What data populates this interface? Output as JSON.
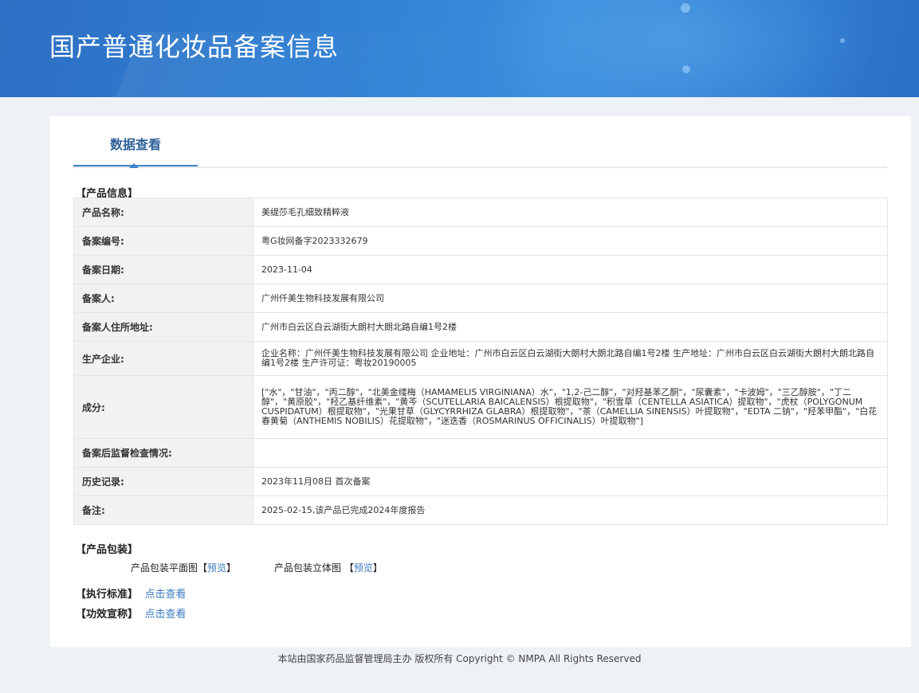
{
  "header": {
    "title": "国产普通化妆品备案信息"
  },
  "tab": {
    "label": "数据查看"
  },
  "product_info": {
    "section_label": "【产品信息】",
    "rows": [
      {
        "key": "产品名称:",
        "value": "美缇莎毛孔细致精粹液"
      },
      {
        "key": "备案编号:",
        "value": "粤G妆网备字2023332679"
      },
      {
        "key": "备案日期:",
        "value": "2023-11-04"
      },
      {
        "key": "备案人:",
        "value": "广州仟美生物科技发展有限公司"
      },
      {
        "key": "备案人住所地址:",
        "value": "广州市白云区白云湖街大朗村大朗北路自编1号2楼"
      },
      {
        "key": "生产企业:",
        "value": "企业名称：广州仟美生物科技发展有限公司 企业地址：广州市白云区白云湖街大朗村大朗北路自编1号2楼 生产地址：广州市白云区白云湖街大朗村大朗北路自编1号2楼 生产许可证：粤妆20190005"
      },
      {
        "key": "成分:",
        "value": "[\"水\"，\"甘油\"，\"丙二醇\"，\"北美金缕梅（HAMAMELIS VIRGINIANA）水\"，\"1,2-己二醇\"，\"对羟基苯乙酮\"，\"尿囊素\"，\"卡波姆\"，\"三乙醇胺\"，\"丁二醇\"，\"黄原胶\"，\"羟乙基纤维素\"，\"黄芩（SCUTELLARIA BAICALENSIS）根提取物\"，\"积雪草（CENTELLA ASIATICA）提取物\"，\"虎杖（POLYGONUM CUSPIDATUM）根提取物\"，\"光果甘草（GLYCYRRHIZA GLABRA）根提取物\"，\"茶（CAMELLIA SINENSIS）叶提取物\"，\"EDTA 二钠\"，\"羟苯甲酯\"，\"白花春黄菊（ANTHEMIS NOBILIS）花提取物\"，\"迷迭香（ROSMARINUS OFFICINALIS）叶提取物\"]"
      },
      {
        "key": "备案后监督检查情况:",
        "value": ""
      },
      {
        "key": "历史记录:",
        "value": "2023年11月08日 首次备案"
      },
      {
        "key": "备注:",
        "value": "2025-02-15,该产品已完成2024年度报告"
      }
    ]
  },
  "packaging": {
    "section_label": "【产品包装】",
    "flat_label": "产品包装平面图",
    "stereo_label": "产品包装立体图",
    "preview_link": "预览",
    "bracket_open": "【",
    "bracket_close": "】"
  },
  "standard": {
    "label": "【执行标准】",
    "link": "点击查看"
  },
  "efficacy": {
    "label": "【功效宣称】",
    "link": "点击查看"
  },
  "footer": {
    "text": "本站由国家药品监督管理局主办 版权所有 Copyright © NMPA All Rights Reserved"
  }
}
